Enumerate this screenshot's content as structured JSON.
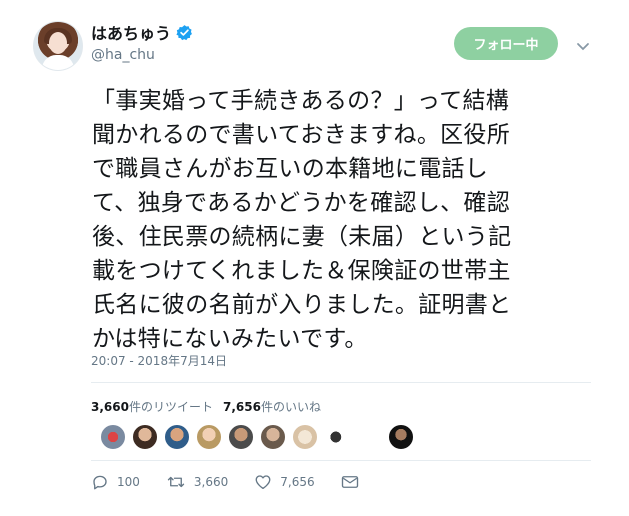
{
  "user": {
    "display_name": "はあちゅう",
    "handle": "@ha_chu",
    "verified_icon": "verified-badge-icon"
  },
  "follow_button": {
    "label": "フォロー中"
  },
  "tweet": {
    "lines": [
      "「事実婚って手続きあるの？」って結構",
      "聞かれるので書いておきますね。区役所",
      "で職員さんがお互いの本籍地に電話し",
      "て、独身であるかどうかを確認し、確認",
      "後、住民票の続柄に妻（未届）という記",
      "載をつけてくれました＆保険証の世帯主",
      "氏名に彼の名前が入りました。証明書と",
      "かは特にないみたいです。"
    ],
    "timestamp": "20:07 - 2018年7月14日"
  },
  "stats": {
    "retweets_count": "3,660",
    "retweets_label": "件のリツイート",
    "likes_count": "7,656",
    "likes_label": "件のいいね"
  },
  "actions": {
    "reply_count": "100",
    "retweet_count": "3,660",
    "like_count": "7,656"
  },
  "colors": {
    "follow_button_bg": "#8ed0a1",
    "verified_blue": "#1da1f2",
    "muted_text": "#657786"
  }
}
